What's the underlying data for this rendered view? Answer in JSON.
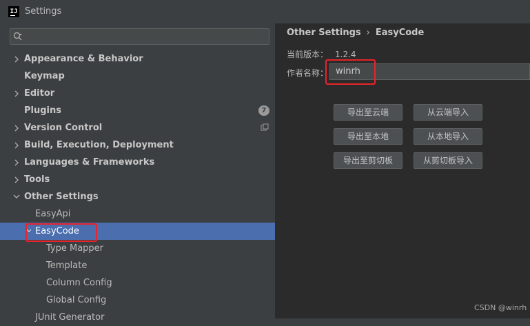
{
  "window": {
    "title": "Settings",
    "app_icon_text": "IJ"
  },
  "search": {
    "placeholder": ""
  },
  "tree": {
    "appearance": "Appearance & Behavior",
    "keymap": "Keymap",
    "editor": "Editor",
    "plugins": "Plugins",
    "plugins_badge": "7",
    "version_control": "Version Control",
    "build": "Build, Execution, Deployment",
    "languages": "Languages & Frameworks",
    "tools": "Tools",
    "other_settings": "Other Settings",
    "easyapi": "EasyApi",
    "easycode": "EasyCode",
    "type_mapper": "Type Mapper",
    "template": "Template",
    "column_config": "Column Config",
    "global_config": "Global Config",
    "junit": "JUnit Generator"
  },
  "breadcrumb": {
    "parent": "Other Settings",
    "separator": "›",
    "current": "EasyCode"
  },
  "info": {
    "version_label": "当前版本：",
    "version_value": "1.2.4",
    "author_label": "作者名称：",
    "author_value": "winrh"
  },
  "buttons": {
    "export_cloud": "导出至云端",
    "import_cloud": "从云端导入",
    "export_local": "导出至本地",
    "import_local": "从本地导入",
    "export_clipboard": "导出至剪切板",
    "import_clipboard": "从剪切板导入"
  },
  "watermark": "CSDN @winrh",
  "colors": {
    "selection": "#4b6eaf",
    "highlight_box": "#e8232a",
    "panel_dark": "#2b2b2b",
    "panel": "#3c3f41"
  }
}
